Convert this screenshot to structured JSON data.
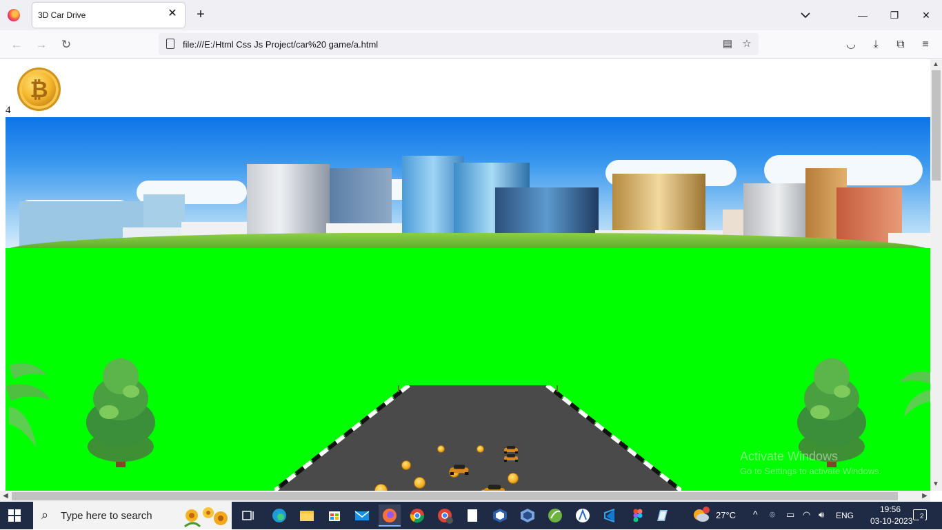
{
  "browser": {
    "tab_title": "3D Car Drive",
    "url": "file:///E:/Html Css Js Project/car%20 game/a.html"
  },
  "page": {
    "score": "4",
    "coin_symbol": "₿"
  },
  "watermark": {
    "title": "Activate Windows",
    "subtitle": "Go to Settings to activate Windows."
  },
  "taskbar": {
    "search_placeholder": "Type here to search",
    "temperature": "27°C",
    "language": "ENG",
    "time": "19:56",
    "date": "03-10-2023",
    "notification_count": "2"
  },
  "colors": {
    "grass": "#00ff00",
    "road": "#4a4a4a",
    "taskbar": "#1f2a44"
  }
}
